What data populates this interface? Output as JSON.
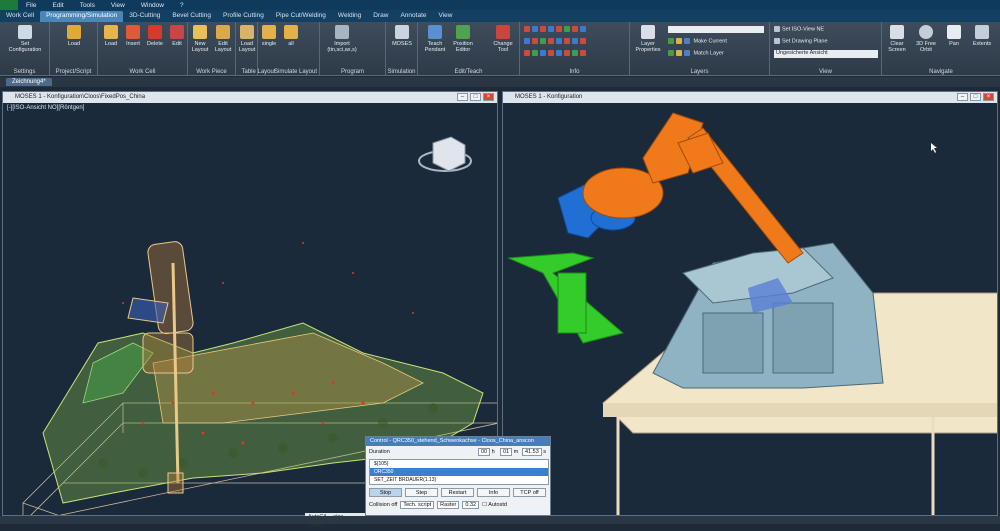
{
  "menubar": {
    "items": [
      "File",
      "Edit",
      "Tools",
      "View",
      "Window",
      "?"
    ]
  },
  "ribbon_tabs": [
    "Work Cell",
    "Programming/Simulation",
    "3D-Cutting",
    "Bevel Cutting",
    "Profile Cutting",
    "Pipe Cut/Welding",
    "Welding",
    "Draw",
    "Annotate",
    "View"
  ],
  "active_tab": "Programming/Simulation",
  "ribbon": {
    "settings": {
      "set_config": "Set Configuration",
      "group": "Settings"
    },
    "project": {
      "load": "Load",
      "group": "Project/Script"
    },
    "workcell": {
      "load": "Load",
      "insert": "Insert",
      "delete": "Delete",
      "edit": "Edit",
      "group": "Work Cell"
    },
    "workpiece": {
      "new": "New Layout",
      "edit": "Edit Layout",
      "group": "Work Piece"
    },
    "tablelayout": {
      "load": "Load Layout",
      "group": "Table Layout"
    },
    "simlayout": {
      "single": "single",
      "all": "all",
      "group": "Simulate Layout"
    },
    "program": {
      "import": "Import (tin,sci,ax,s)",
      "group": "Program"
    },
    "simulation": {
      "moses": "MOSES",
      "group": "Simulation"
    },
    "editteach": {
      "teach": "Teach Pendant",
      "position": "Position Editor",
      "change_tool": "Change Tool",
      "group": "Edit/Teach"
    },
    "info": {
      "group": "Info"
    },
    "layers": {
      "props": "Layer Properties",
      "make_current": "Make Current",
      "match_layer": "Match Layer",
      "group": "Layers"
    },
    "view": {
      "set_iso": "Set ISO-View NE",
      "set_plane": "Set Drawing Plane",
      "visual_style": "Ungesicherte Ansicht",
      "group": "View"
    },
    "navigate": {
      "clear": "Clear Screen",
      "orbit": "3D Free Orbit",
      "pan": "Pan",
      "extents": "Extents",
      "group": "Navigate"
    }
  },
  "doc_tab": "Zeichnung4*",
  "viewport_left": {
    "title": "MOSES 1 - Konfiguration\\Cloos\\FixedPos_China",
    "label": "[-][ISO-Ansicht NO][Röntgen]"
  },
  "viewport_right": {
    "title": "MOSES 1 - Konfiguration"
  },
  "control_dialog": {
    "title": "Control - QRC350_stehend_Schwenkachse - Cloos_China_anscon",
    "duration_label": "Duration",
    "hours": "00",
    "h": "h",
    "minutes": "01",
    "m": "m",
    "seconds": "41.53",
    "s": "s",
    "list": [
      "${105}",
      "ORC350",
      "SET_ZEIT BRDAUER(1.13)"
    ],
    "selected_index": 1,
    "buttons": [
      "Stop",
      "Step",
      "Restart",
      "Info",
      "TCP off"
    ],
    "collision": "Collision off",
    "tech_script": "Tech. script",
    "raster": "Raster",
    "raster_value": "0.32",
    "autostd": "Autostd"
  },
  "taskbar_item": "AutoCA... eine Zeichn...",
  "colors": {
    "menubar": "#0f3a5c",
    "tab_active": "#4a86b8",
    "viewport_bg": "#1b2a3a",
    "robot_orange": "#f07a1a",
    "robot_blue": "#1f6fd4",
    "robot_green": "#33cc2a",
    "fixture": "#8fb3c2",
    "table": "#f2e6c9"
  }
}
